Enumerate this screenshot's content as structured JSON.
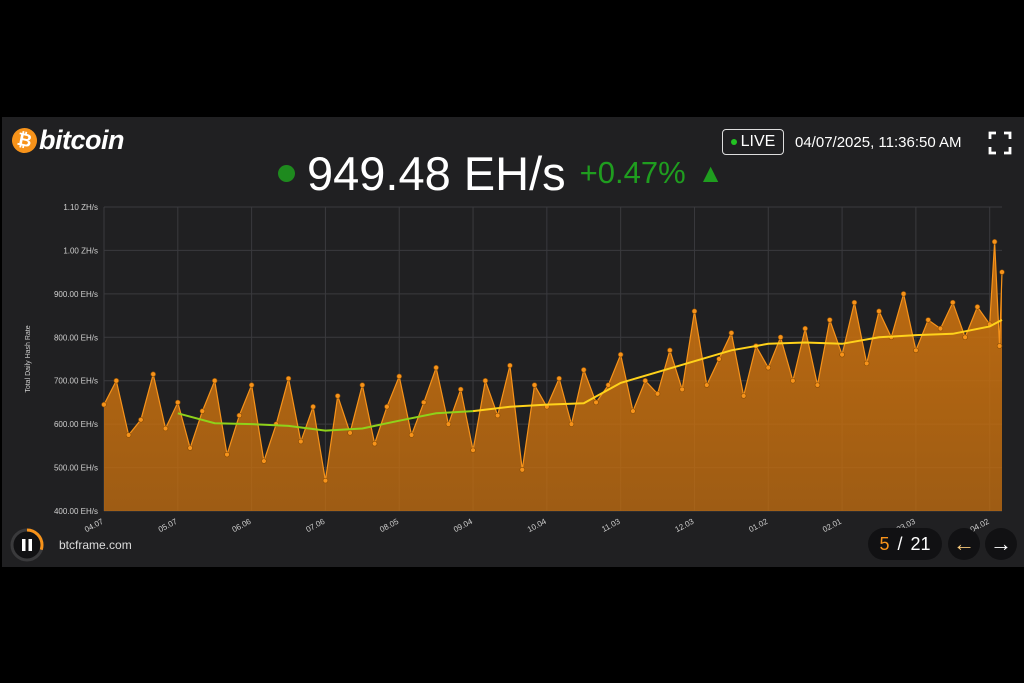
{
  "header": {
    "logo_symbol": "₿",
    "logo_text": "bitcoin",
    "live_label": "LIVE",
    "datetime": "04/07/2025, 11:36:50 AM",
    "fullscreen_icon": "fullscreen-icon"
  },
  "headline": {
    "value": "949.48 EH/s",
    "change": "+0.47%",
    "arrow": "▲",
    "status_color": "#1e8a1e",
    "change_color": "#1f9d1f"
  },
  "footer": {
    "site": "btcframe.com",
    "current_page": "5",
    "separator": "/",
    "total_pages": "21",
    "prev_icon": "←",
    "next_icon": "→",
    "pause_icon": "pause-icon",
    "pause_progress": 0.3
  },
  "colors": {
    "accent": "#f7931a",
    "area_fill": "#c8700f",
    "ma_line": "#ffd21a",
    "ma_line_early": "#8fd21a",
    "background": "#202022"
  },
  "chart_data": {
    "type": "area",
    "ylabel": "Total Daily Hash Rate",
    "ylim": [
      400,
      1100
    ],
    "yticks": [
      400,
      500,
      600,
      700,
      800,
      900,
      1000,
      1100
    ],
    "ytick_labels": [
      "400.00 EH/s",
      "500.00 EH/s",
      "600.00 EH/s",
      "700.00 EH/s",
      "800.00 EH/s",
      "900.00 EH/s",
      "1.00 ZH/s",
      "1.10 ZH/s"
    ],
    "xlim": [
      "2024-04-07",
      "2025-04-07"
    ],
    "xticks": [
      "2024-04-07",
      "2024-05-07",
      "2024-06-06",
      "2024-07-06",
      "2024-08-05",
      "2024-09-04",
      "2024-10-04",
      "2024-11-03",
      "2024-12-03",
      "2025-01-02",
      "2025-02-01",
      "2025-03-03",
      "2025-04-02"
    ],
    "xtick_labels": [
      "04.07",
      "05.07",
      "06.06",
      "07.06",
      "08.05",
      "09.04",
      "10.04",
      "11.03",
      "12.03",
      "01.02",
      "02.01",
      "03.03",
      "04.02"
    ],
    "grid": true,
    "series": [
      {
        "x": [
          "2024-04-07",
          "2024-04-12",
          "2024-04-17",
          "2024-04-22",
          "2024-04-27",
          "2024-05-02",
          "2024-05-07",
          "2024-05-12",
          "2024-05-17",
          "2024-05-22",
          "2024-05-27",
          "2024-06-01",
          "2024-06-06",
          "2024-06-11",
          "2024-06-16",
          "2024-06-21",
          "2024-06-26",
          "2024-07-01",
          "2024-07-06",
          "2024-07-11",
          "2024-07-16",
          "2024-07-21",
          "2024-07-26",
          "2024-07-31",
          "2024-08-05",
          "2024-08-10",
          "2024-08-15",
          "2024-08-20",
          "2024-08-25",
          "2024-08-30",
          "2024-09-04",
          "2024-09-09",
          "2024-09-14",
          "2024-09-19",
          "2024-09-24",
          "2024-09-29",
          "2024-10-04",
          "2024-10-09",
          "2024-10-14",
          "2024-10-19",
          "2024-10-24",
          "2024-10-29",
          "2024-11-03",
          "2024-11-08",
          "2024-11-13",
          "2024-11-18",
          "2024-11-23",
          "2024-11-28",
          "2024-12-03",
          "2024-12-08",
          "2024-12-13",
          "2024-12-18",
          "2024-12-23",
          "2024-12-28",
          "2025-01-02",
          "2025-01-07",
          "2025-01-12",
          "2025-01-17",
          "2025-01-22",
          "2025-01-27",
          "2025-02-01",
          "2025-02-06",
          "2025-02-11",
          "2025-02-16",
          "2025-02-21",
          "2025-02-26",
          "2025-03-03",
          "2025-03-08",
          "2025-03-13",
          "2025-03-18",
          "2025-03-23",
          "2025-03-28",
          "2025-04-02",
          "2025-04-04",
          "2025-04-06",
          "2025-04-07"
        ],
        "values": [
          645,
          700,
          575,
          610,
          715,
          590,
          650,
          545,
          630,
          700,
          530,
          620,
          690,
          515,
          600,
          705,
          560,
          640,
          470,
          665,
          580,
          690,
          555,
          640,
          710,
          575,
          650,
          730,
          600,
          680,
          540,
          700,
          620,
          735,
          495,
          690,
          640,
          705,
          600,
          725,
          650,
          690,
          760,
          630,
          700,
          670,
          770,
          680,
          860,
          690,
          750,
          810,
          665,
          780,
          730,
          800,
          700,
          820,
          690,
          840,
          760,
          880,
          740,
          860,
          800,
          900,
          770,
          840,
          820,
          880,
          800,
          870,
          830,
          1020,
          780,
          950
        ]
      }
    ],
    "moving_average": {
      "x": [
        "2024-05-07",
        "2024-05-22",
        "2024-06-06",
        "2024-06-21",
        "2024-07-06",
        "2024-07-21",
        "2024-08-05",
        "2024-08-20",
        "2024-09-04",
        "2024-09-19",
        "2024-10-04",
        "2024-10-19",
        "2024-11-03",
        "2024-11-18",
        "2024-12-03",
        "2024-12-18",
        "2025-01-02",
        "2025-01-17",
        "2025-02-01",
        "2025-02-16",
        "2025-03-03",
        "2025-03-18",
        "2025-04-02",
        "2025-04-07"
      ],
      "values": [
        625,
        602,
        600,
        596,
        585,
        590,
        608,
        625,
        630,
        640,
        645,
        648,
        695,
        720,
        745,
        770,
        785,
        788,
        785,
        800,
        805,
        808,
        825,
        840
      ]
    }
  }
}
